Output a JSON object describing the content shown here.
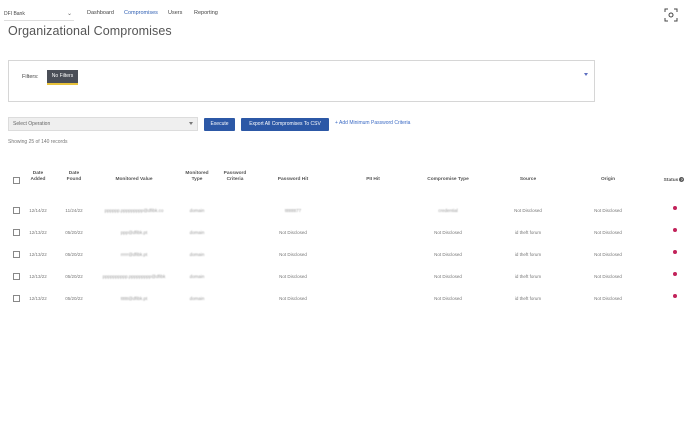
{
  "topnav": {
    "org_selector": "DFI Bank",
    "links": [
      "Dashboard",
      "Compromises",
      "Users",
      "Reporting"
    ],
    "active": "Compromises"
  },
  "page_title": "Organizational Compromises",
  "filters": {
    "label": "Filters:",
    "chip": "No Filters"
  },
  "toolbar": {
    "operation_placeholder": "Select Operation",
    "execute_label": "Execute",
    "export_label": "Export All Compromises To CSV",
    "add_criteria_link": "+ Add Minimum Password Criteria"
  },
  "records_text": "Showing 25 of 140 records",
  "table": {
    "columns": [
      "Date Added",
      "Date Found",
      "Monitored Value",
      "Monitored Type",
      "Password Criteria",
      "Password Hit",
      "PII Hit",
      "Compromise Type",
      "Source",
      "Origin",
      "Status"
    ],
    "rows": [
      {
        "date_added": "12/14/22",
        "date_found": "11/24/22",
        "monitored_value": "pppppp.ppppppppp@dfibk.co",
        "monitored_type": "domain",
        "password_criteria": "",
        "password_hit": "ttttttttt77",
        "pii_hit": "",
        "compromise_type": "credential",
        "source": "Not Disclosed",
        "origin": "Not Disclosed"
      },
      {
        "date_added": "12/13/22",
        "date_found": "05/20/22",
        "monitored_value": "ppp@dfibk.pt",
        "monitored_type": "domain",
        "password_criteria": "",
        "password_hit": "Not Disclosed",
        "pii_hit": "",
        "compromise_type": "Not Disclosed",
        "source": "id theft forum",
        "origin": "Not Disclosed"
      },
      {
        "date_added": "12/13/22",
        "date_found": "05/20/22",
        "monitored_value": "rrrrr@dfibk.pt",
        "monitored_type": "domain",
        "password_criteria": "",
        "password_hit": "Not Disclosed",
        "pii_hit": "",
        "compromise_type": "Not Disclosed",
        "source": "id theft forum",
        "origin": "Not Disclosed"
      },
      {
        "date_added": "12/13/22",
        "date_found": "05/20/22",
        "monitored_value": "pppppppppp.ppppppppp@dfibk",
        "monitored_type": "domain",
        "password_criteria": "",
        "password_hit": "Not Disclosed",
        "pii_hit": "",
        "compromise_type": "Not Disclosed",
        "source": "id theft forum",
        "origin": "Not Disclosed"
      },
      {
        "date_added": "12/13/22",
        "date_found": "05/20/22",
        "monitored_value": "tttttt@dfibk.pt",
        "monitored_type": "domain",
        "password_criteria": "",
        "password_hit": "Not Disclosed",
        "pii_hit": "",
        "compromise_type": "Not Disclosed",
        "source": "id theft forum",
        "origin": "Not Disclosed"
      }
    ]
  },
  "colors": {
    "accent": "#2c58a6",
    "status_dot": "#c2225a",
    "chip_bg": "#4a4e57",
    "chip_underline": "#e8c23a"
  },
  "icons": {
    "topright": "camera-scan-icon",
    "filter_toggle": "chevron-down-icon",
    "status_header": "info-icon"
  }
}
